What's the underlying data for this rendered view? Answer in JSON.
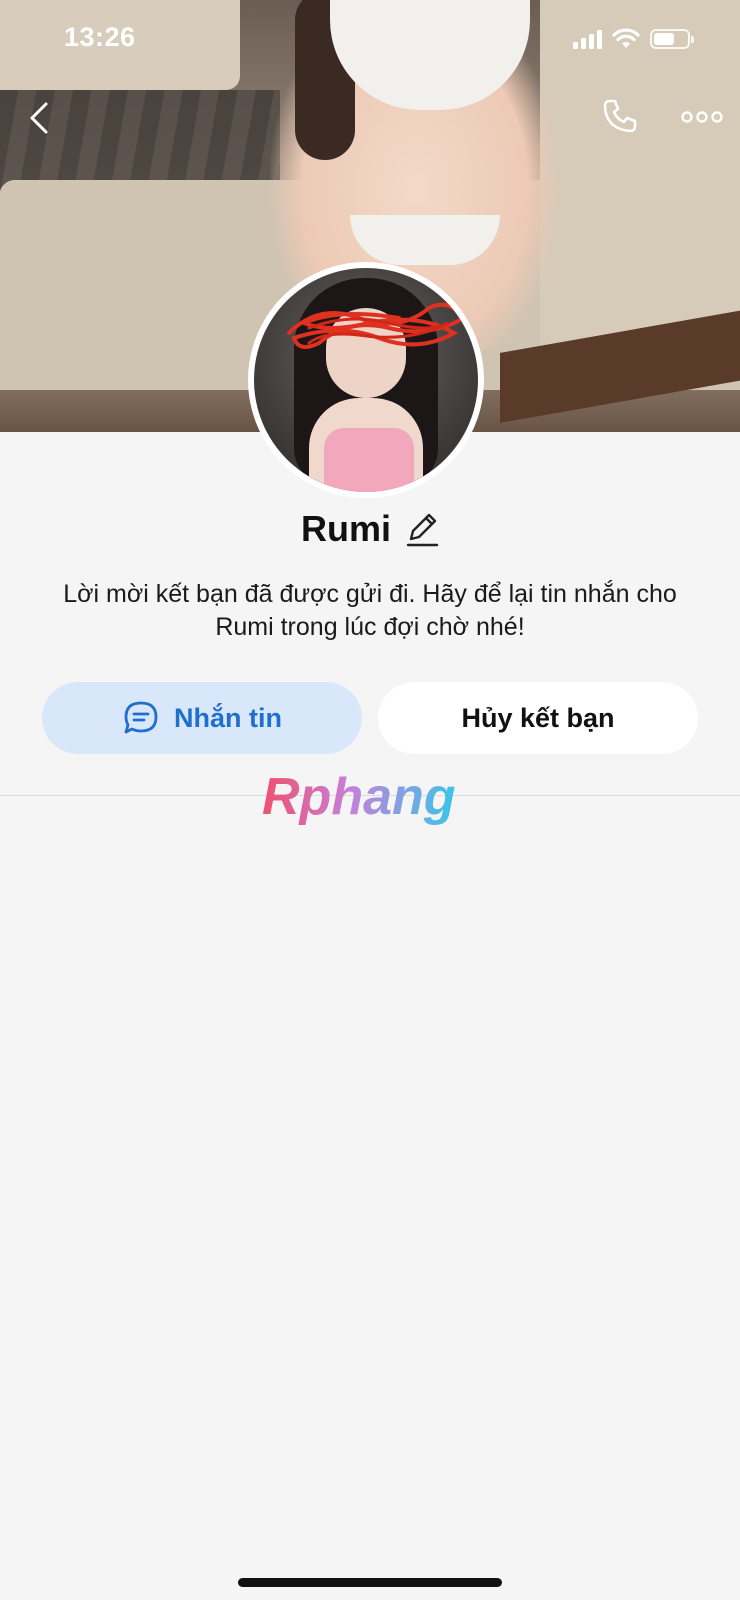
{
  "status_bar": {
    "time": "13:26"
  },
  "header": {
    "back_icon": "chevron-left-icon",
    "call_icon": "phone-icon",
    "more_icon": "more-dots-icon"
  },
  "profile": {
    "name": "Rumi",
    "edit_icon": "pencil-icon",
    "request_message": "Lời mời kết bạn đã được gửi đi. Hãy để lại tin nhắn cho Rumi trong lúc đợi chờ nhé!"
  },
  "actions": {
    "message_label": "Nhắn tin",
    "message_icon": "chat-bubble-icon",
    "unfriend_label": "Hủy kết bạn"
  },
  "watermark": {
    "text": "Rphang"
  },
  "colors": {
    "accent": "#1f6fcf",
    "message_button_bg": "#d8e8fa",
    "page_bg": "#f5f5f5"
  }
}
